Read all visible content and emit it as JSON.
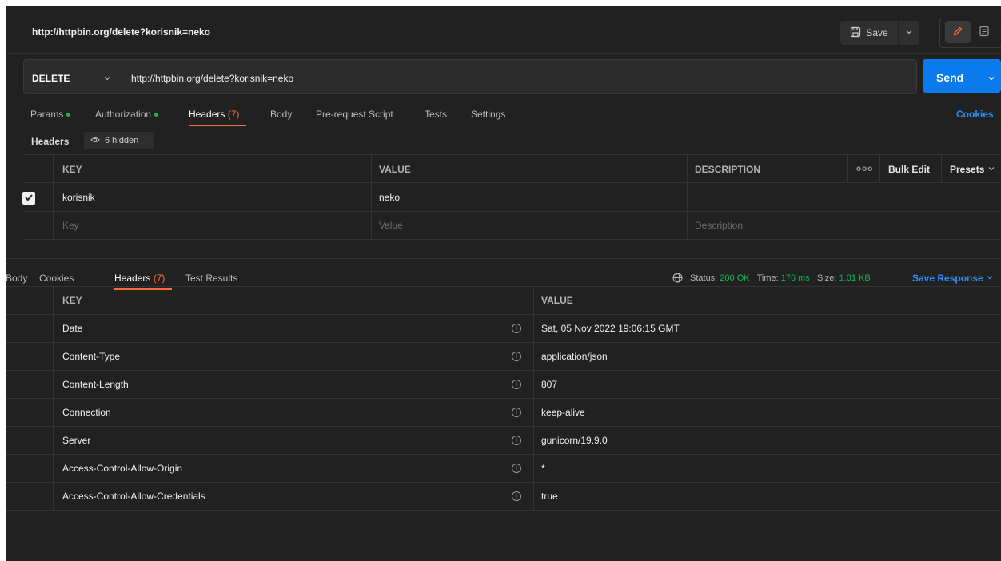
{
  "request": {
    "title": "http://httpbin.org/delete?korisnik=neko",
    "method": "DELETE",
    "url": "http://httpbin.org/delete?korisnik=neko",
    "save_label": "Save",
    "send_label": "Send",
    "cookies_label": "Cookies"
  },
  "request_tabs": [
    {
      "label": "Params",
      "indicator": "dot"
    },
    {
      "label": "Authorization",
      "indicator": "dot"
    },
    {
      "label": "Headers",
      "count": "(7)",
      "active": true
    },
    {
      "label": "Body"
    },
    {
      "label": "Pre-request Script"
    },
    {
      "label": "Tests"
    },
    {
      "label": "Settings"
    }
  ],
  "headers_section": {
    "label": "Headers",
    "hidden_badge": "6 hidden",
    "columns": {
      "key": "KEY",
      "value": "VALUE",
      "description": "DESCRIPTION"
    },
    "more_label": "ooo",
    "bulk_edit_label": "Bulk Edit",
    "presets_label": "Presets",
    "rows": [
      {
        "checked": true,
        "key": "korisnik",
        "value": "neko",
        "description": ""
      }
    ],
    "placeholders": {
      "key": "Key",
      "value": "Value",
      "description": "Description"
    }
  },
  "response": {
    "tabs": [
      {
        "label": "Body"
      },
      {
        "label": "Cookies"
      },
      {
        "label": "Headers",
        "count": "(7)",
        "active": true
      },
      {
        "label": "Test Results"
      }
    ],
    "status_label": "Status:",
    "status_value": "200 OK",
    "time_label": "Time:",
    "time_value": "176 ms",
    "size_label": "Size:",
    "size_value": "1.01 KB",
    "save_response_label": "Save Response",
    "columns": {
      "key": "KEY",
      "value": "VALUE"
    },
    "headers": [
      {
        "key": "Date",
        "value": "Sat, 05 Nov 2022 19:06:15 GMT"
      },
      {
        "key": "Content-Type",
        "value": "application/json"
      },
      {
        "key": "Content-Length",
        "value": "807"
      },
      {
        "key": "Connection",
        "value": "keep-alive"
      },
      {
        "key": "Server",
        "value": "gunicorn/19.9.0"
      },
      {
        "key": "Access-Control-Allow-Origin",
        "value": "*"
      },
      {
        "key": "Access-Control-Allow-Credentials",
        "value": "true"
      }
    ]
  },
  "colors": {
    "accent": "#ff6c37",
    "send_blue": "#097bed",
    "link_blue": "#2a90f7",
    "status_green": "#0cbb52",
    "background": "#212121"
  },
  "icons": [
    "save-icon",
    "chevron-down-icon",
    "pencil-icon",
    "document-icon",
    "eye-icon",
    "checkmark-icon",
    "globe-icon",
    "info-icon"
  ]
}
